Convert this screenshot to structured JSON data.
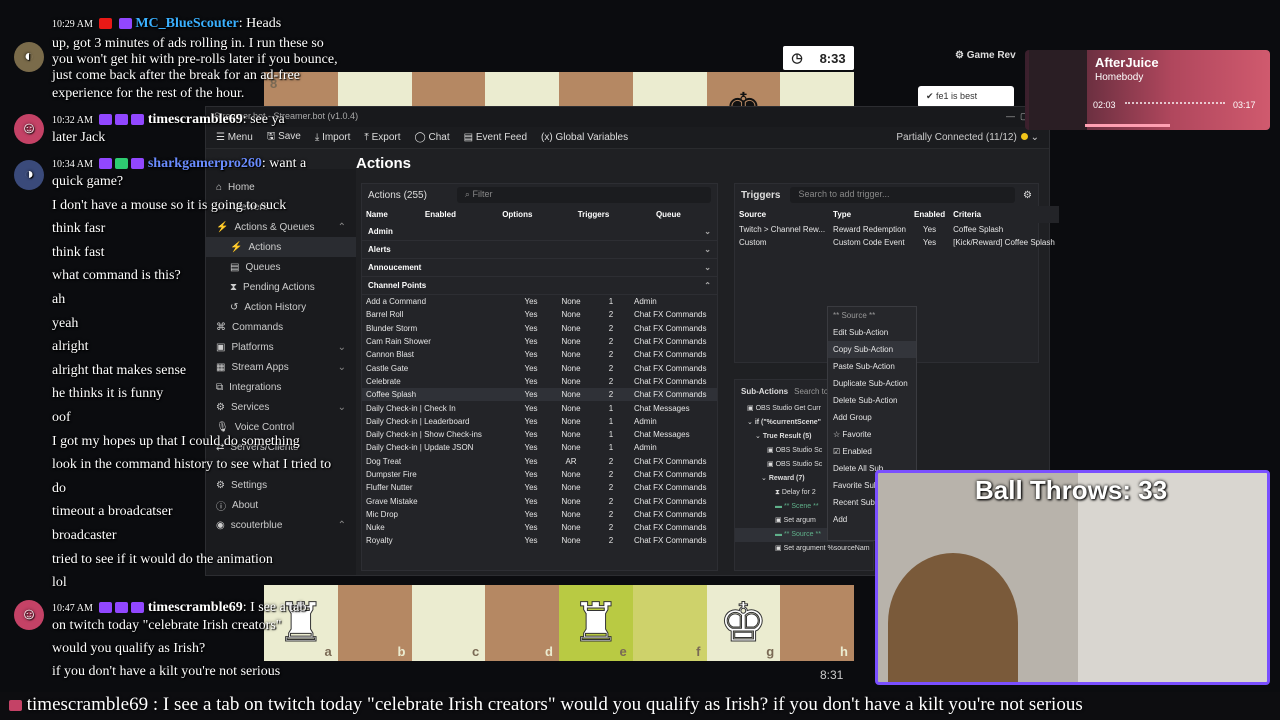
{
  "board": {
    "top_rank": "8",
    "files": [
      "a",
      "b",
      "c",
      "d",
      "e",
      "f",
      "g",
      "h"
    ],
    "bottom_clock": "8:31",
    "top_timer": "8:33",
    "game_review": "Game Rev",
    "best_move": "fe1 is best"
  },
  "chat": [
    {
      "time": "10:29 AM",
      "user": "MC_BlueScouter",
      "text": ": Heads"
    },
    {
      "line": "up, got 3 minutes of ads rolling in. I run these so"
    },
    {
      "line": "you won't get hit with pre-rolls later if you bounce,"
    },
    {
      "line": "just come back after the break for an ad-free"
    },
    {
      "line": "experience for the rest of the hour."
    }
  ],
  "chat2": {
    "time1": "10:32 AM",
    "user1": "timescramble69",
    "text1": ": see ya",
    "line1b": "later Jack",
    "time2": "10:34 AM",
    "user2": "sharkgamerpro260",
    "text2": ": want a",
    "lines": [
      "quick game?",
      "I don't have a mouse so it is going to suck",
      "think fasr",
      "think fast",
      "what command is this?",
      "ah",
      "yeah",
      "alright",
      "alright that makes sense",
      "he thinks it is funny",
      "oof",
      "I got my hopes up that I could do something",
      "look in the command history to see what I tried to",
      "do",
      "timeout a broadcatser",
      "broadcaster",
      "tried to see if it would do the animation",
      "lol"
    ],
    "time3": "10:47 AM",
    "user3": "timescramble69",
    "text3": ": I see a tab",
    "lines3": [
      "on twitch today \"celebrate Irish creators\"",
      "would you qualify as Irish?",
      "if you don't have a kilt you're not serious"
    ]
  },
  "streamerbot": {
    "title": "Streamer.bot - Streamer.bot (v1.0.4)",
    "menu": [
      "Menu",
      "Save",
      "Import",
      "Export",
      "Chat",
      "Event Feed",
      "Global Variables"
    ],
    "connection": "Partially Connected (11/12)",
    "heading": "Actions",
    "sidebar": [
      "Home",
      "Viewers",
      "Actions & Queues",
      "Actions",
      "Queues",
      "Pending Actions",
      "Action History",
      "Commands",
      "Platforms",
      "Stream Apps",
      "Integrations",
      "Services",
      "Voice Control",
      "Servers/Clients",
      "Settings",
      "About",
      "scouterblue"
    ],
    "actions_count": "Actions (255)",
    "filter_placeholder": "Filter",
    "columns": [
      "Name",
      "Enabled",
      "Options",
      "Triggers",
      "Queue"
    ],
    "groups": [
      "Admin",
      "Alerts",
      "Annoucement",
      "Channel Points"
    ],
    "rows": [
      [
        "Add a Command",
        "Yes",
        "None",
        "1",
        "Admin"
      ],
      [
        "Barrel Roll",
        "Yes",
        "None",
        "2",
        "Chat FX Commands"
      ],
      [
        "Blunder Storm",
        "Yes",
        "None",
        "2",
        "Chat FX Commands"
      ],
      [
        "Cam Rain Shower",
        "Yes",
        "None",
        "2",
        "Chat FX Commands"
      ],
      [
        "Cannon Blast",
        "Yes",
        "None",
        "2",
        "Chat FX Commands"
      ],
      [
        "Castle Gate",
        "Yes",
        "None",
        "2",
        "Chat FX Commands"
      ],
      [
        "Celebrate",
        "Yes",
        "None",
        "2",
        "Chat FX Commands"
      ],
      [
        "Coffee Splash",
        "Yes",
        "None",
        "2",
        "Chat FX Commands"
      ],
      [
        "Daily Check-in | Check In",
        "Yes",
        "None",
        "1",
        "Chat Messages"
      ],
      [
        "Daily Check-in | Leaderboard",
        "Yes",
        "None",
        "1",
        "Admin"
      ],
      [
        "Daily Check-in | Show Check-ins",
        "Yes",
        "None",
        "1",
        "Chat Messages"
      ],
      [
        "Daily Check-in | Update JSON",
        "Yes",
        "None",
        "1",
        "Admin"
      ],
      [
        "Dog Treat",
        "Yes",
        "AR",
        "2",
        "Chat FX Commands"
      ],
      [
        "Dumpster Fire",
        "Yes",
        "None",
        "2",
        "Chat FX Commands"
      ],
      [
        "Fluffer Nutter",
        "Yes",
        "None",
        "2",
        "Chat FX Commands"
      ],
      [
        "Grave Mistake",
        "Yes",
        "None",
        "2",
        "Chat FX Commands"
      ],
      [
        "Mic Drop",
        "Yes",
        "None",
        "2",
        "Chat FX Commands"
      ],
      [
        "Nuke",
        "Yes",
        "None",
        "2",
        "Chat FX Commands"
      ],
      [
        "Royalty",
        "Yes",
        "None",
        "2",
        "Chat FX Commands"
      ]
    ],
    "triggers": {
      "label": "Triggers",
      "placeholder": "Search to add trigger...",
      "columns": [
        "Source",
        "Type",
        "Enabled",
        "Criteria"
      ],
      "rows": [
        [
          "Twitch > Channel Rew...",
          "Reward Redemption",
          "Yes",
          "Coffee Splash"
        ],
        [
          "Custom",
          "Custom Code Event",
          "Yes",
          "[Kick/Reward] Coffee Splash"
        ]
      ]
    },
    "subactions": {
      "label": "Sub-Actions",
      "placeholder": "Search to ad",
      "tree": [
        "OBS Studio Get Curr",
        "if (\"%currentScene\"",
        "True Result (5)",
        "OBS Studio Sc",
        "OBS Studio Sc",
        "Reward (7)",
        "Delay for 2",
        "** Scene **",
        "Set argum",
        "** Source **",
        "Set argument %sourceNam"
      ]
    },
    "context_menu": [
      "** Source **",
      "Edit Sub-Action",
      "Copy Sub-Action",
      "Paste Sub-Action",
      "Duplicate Sub-Action",
      "Delete Sub-Action",
      "Add Group",
      "Favorite",
      "Enabled",
      "Delete All Sub",
      "Favorite Sub",
      "Recent Sub-A",
      "Add"
    ]
  },
  "music": {
    "title": "AfterJuice",
    "artist": "Homebody",
    "elapsed": "02:03",
    "total": "03:17",
    "progress": 0.62
  },
  "overlay": {
    "ball_throws": "Ball Throws: 33"
  },
  "ticker": "timescramble69 : I see a tab on twitch today \"celebrate Irish creators\" would you qualify as Irish? if you don't have a kilt you're not serious"
}
